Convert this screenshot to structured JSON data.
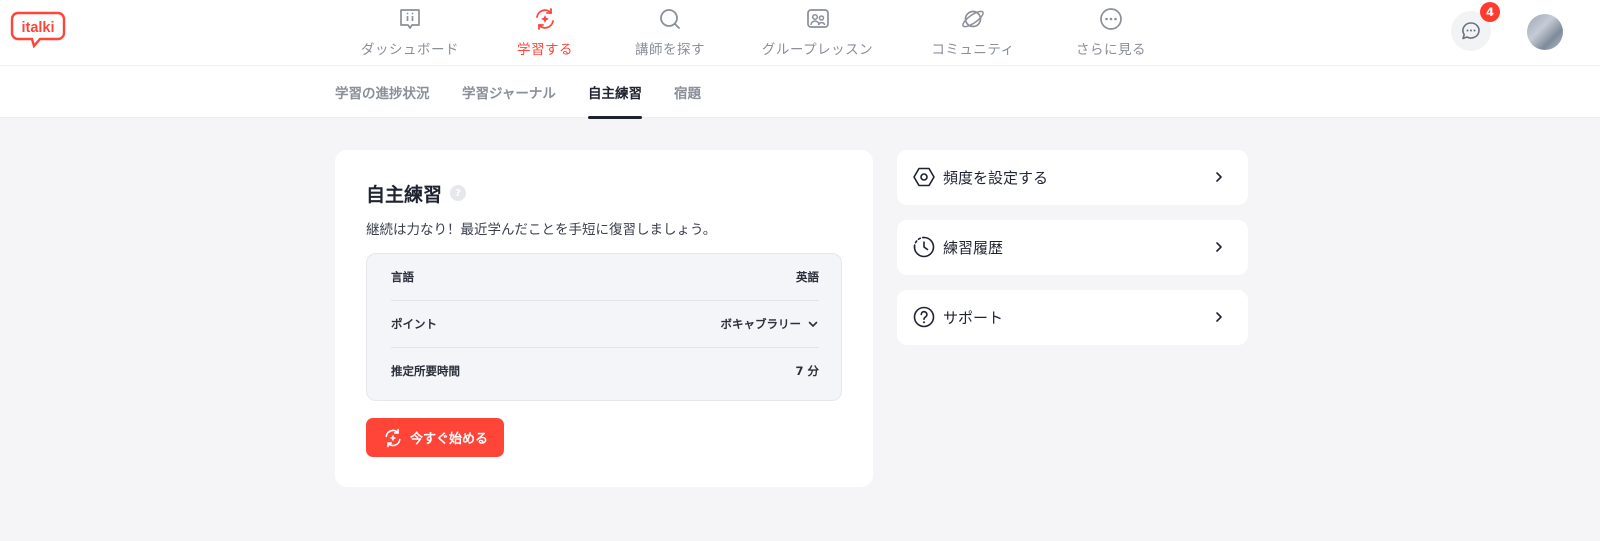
{
  "header": {
    "logo_text": "italki",
    "nav": [
      {
        "label": "ダッシュボード",
        "icon": "dashboard-icon"
      },
      {
        "label": "学習する",
        "icon": "learn-icon",
        "active": true
      },
      {
        "label": "講師を探す",
        "icon": "search-icon"
      },
      {
        "label": "グループレッスン",
        "icon": "group-lesson-icon"
      },
      {
        "label": "コミュニティ",
        "icon": "community-icon"
      },
      {
        "label": "さらに見る",
        "icon": "more-icon"
      }
    ],
    "message_badge": "4",
    "accent_color": "#ff4438"
  },
  "subnav": {
    "tabs": [
      {
        "label": "学習の進捗状況"
      },
      {
        "label": "学習ジャーナル"
      },
      {
        "label": "自主練習",
        "active": true
      },
      {
        "label": "宿題"
      }
    ]
  },
  "practice": {
    "title": "自主練習",
    "help": "?",
    "description": "継続は力なり！最近学んだことを手短に復習しましょう。",
    "rows": [
      {
        "label": "言語",
        "value": "英語"
      },
      {
        "label": "ポイント",
        "value": "ボキャブラリー"
      },
      {
        "label": "推定所要時間",
        "value": "7 分"
      }
    ],
    "start_button": "今すぐ始める"
  },
  "side": {
    "items": [
      {
        "label": "頻度を設定する",
        "icon": "hexagon-settings-icon"
      },
      {
        "label": "練習履歴",
        "icon": "history-clock-icon"
      },
      {
        "label": "サポート",
        "icon": "help-circle-icon"
      }
    ]
  }
}
